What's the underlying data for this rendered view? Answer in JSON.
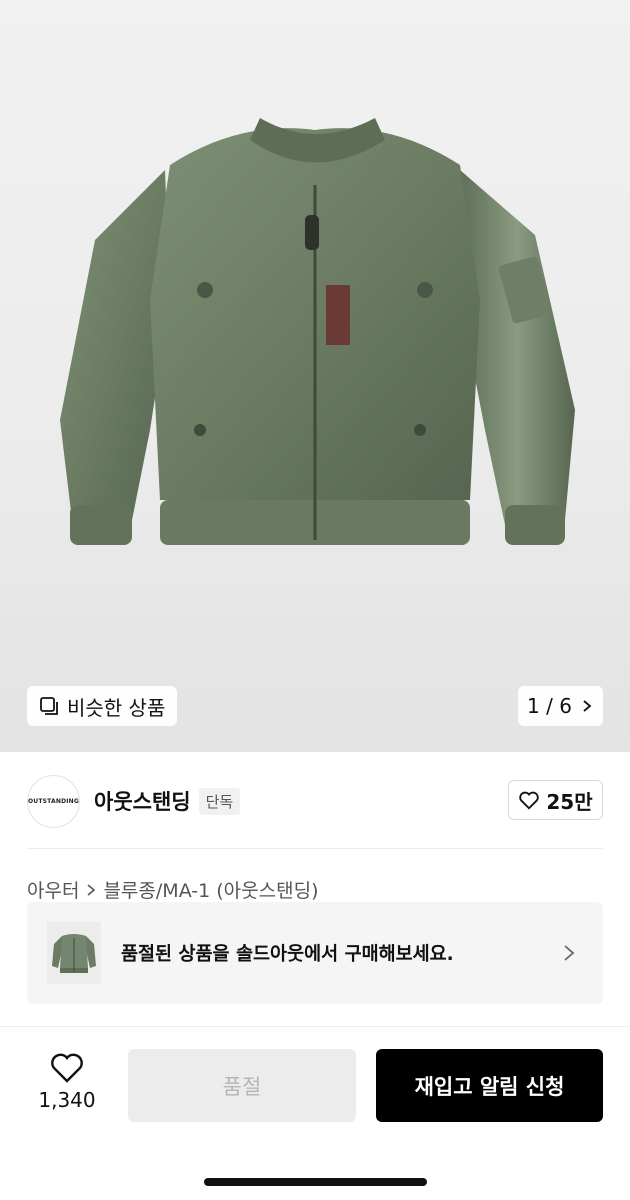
{
  "hero": {
    "image_icon": "bomber-jacket-image",
    "similar_label": "비슷한 상품",
    "pager": "1 / 6"
  },
  "brand": {
    "logo_text": "OUTSTANDING",
    "name": "아웃스탠딩",
    "badge": "단독",
    "likes": "25만"
  },
  "breadcrumb": {
    "category": "아우터",
    "subcategory": "블루종/MA-1 (아웃스탠딩)"
  },
  "banner": {
    "text": "품절된 상품을 솔드아웃에서 구매해보세요."
  },
  "bottom_bar": {
    "wish_count": "1,340",
    "soldout_label": "품절",
    "restock_label": "재입고 알림 신청"
  },
  "colors": {
    "jacket": "#6f8067",
    "accent_button": "#000000",
    "disabled_button": "#ececec"
  }
}
